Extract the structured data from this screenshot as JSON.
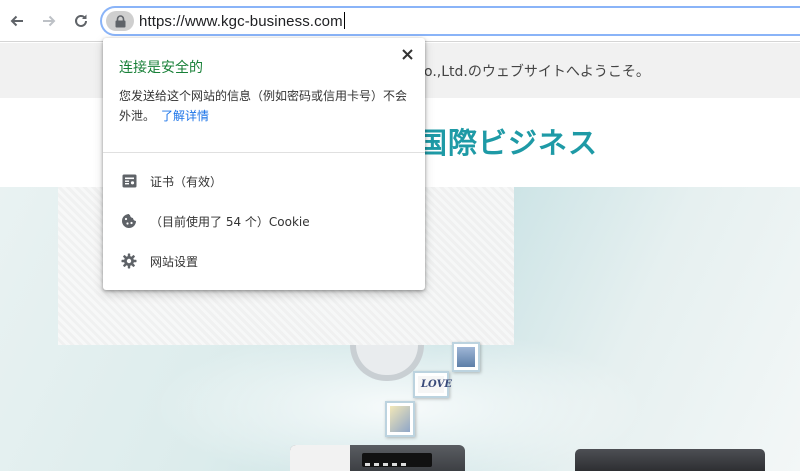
{
  "browser": {
    "url": "https://www.kgc-business.com",
    "back_icon": "arrow-left-icon",
    "forward_icon": "arrow-right-icon",
    "reload_icon": "reload-icon",
    "lock_icon": "lock-icon"
  },
  "website": {
    "welcome_text": "o.,Ltd.のウェブサイトへようこそ。",
    "brand_text": "国際ビジネス",
    "brand_color": "#1e9aa6",
    "frame_text": "LOVE"
  },
  "security_popup": {
    "title": "连接是安全的",
    "title_color": "#188038",
    "description": "您发送给这个网站的信息（例如密码或信用卡号）不会外泄。",
    "learn_more": "了解详情",
    "link_color": "#1a73e8",
    "close_icon": "close-icon",
    "items": [
      {
        "icon": "certificate-icon",
        "label": "证书（有效）"
      },
      {
        "icon": "cookie-icon",
        "label": "（目前使用了 54 个）Cookie"
      },
      {
        "icon": "gear-icon",
        "label": "网站设置"
      }
    ]
  }
}
